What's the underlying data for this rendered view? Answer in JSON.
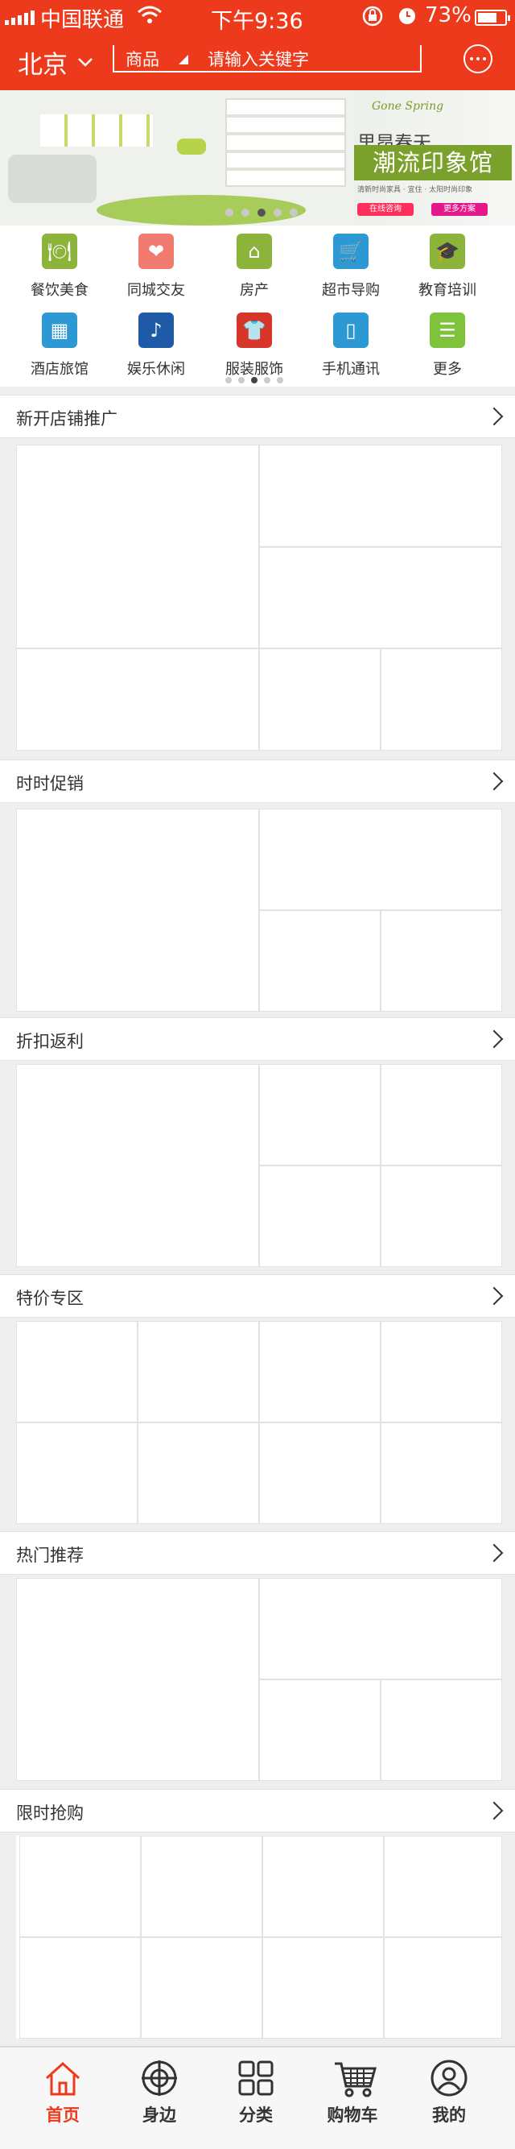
{
  "status": {
    "carrier": "中国联通",
    "time": "下午9:36",
    "battery": "73%",
    "battery_level": 0.73
  },
  "header": {
    "city": "北京",
    "search_category": "商品",
    "search_placeholder": "请输入关键字",
    "accent": "#ed3a1c"
  },
  "banner": {
    "script_text": "Gone Spring",
    "title_1": "里昂春天",
    "title_2": "潮流印象馆",
    "small_text": "清新时尚家具 · 宜住 · 太阳时尚印象",
    "button_1": "在线咨询",
    "button_2": "更多方案",
    "slide_count": 5,
    "active_slide": 3
  },
  "categories": {
    "items": [
      {
        "label": "餐饮美食",
        "icon": "dining-icon",
        "color": "#8cb33a",
        "glyph": "🍽"
      },
      {
        "label": "同城交友",
        "icon": "heart-icon",
        "color": "#f07b6e",
        "glyph": "❤"
      },
      {
        "label": "房产",
        "icon": "house-icon",
        "color": "#8cb33a",
        "glyph": "⌂"
      },
      {
        "label": "超市导购",
        "icon": "cart-icon",
        "color": "#2c98d4",
        "glyph": "🛒"
      },
      {
        "label": "教育培训",
        "icon": "graduate-icon",
        "color": "#8cb33a",
        "glyph": "🎓"
      },
      {
        "label": "酒店旅馆",
        "icon": "hotel-icon",
        "color": "#2c98d4",
        "glyph": "▦"
      },
      {
        "label": "娱乐休闲",
        "icon": "entertainment-icon",
        "color": "#1e5aa8",
        "glyph": "♪"
      },
      {
        "label": "服装服饰",
        "icon": "clothing-icon",
        "color": "#d8352a",
        "glyph": "👕"
      },
      {
        "label": "手机通讯",
        "icon": "phone-icon",
        "color": "#2c98d4",
        "glyph": "▯"
      },
      {
        "label": "更多",
        "icon": "more-list-icon",
        "color": "#7ec33b",
        "glyph": "☰"
      }
    ],
    "page_count": 5,
    "active_page": 3
  },
  "sections": [
    {
      "title": "新开店铺推广"
    },
    {
      "title": "时时促销"
    },
    {
      "title": "折扣返利"
    },
    {
      "title": "特价专区"
    },
    {
      "title": "热门推荐"
    },
    {
      "title": "限时抢购"
    }
  ],
  "tabbar": {
    "items": [
      {
        "label": "首页",
        "icon": "home-icon",
        "active": true
      },
      {
        "label": "身边",
        "icon": "nearby-target-icon",
        "active": false
      },
      {
        "label": "分类",
        "icon": "category-grid-icon",
        "active": false
      },
      {
        "label": "购物车",
        "icon": "shopping-cart-icon",
        "active": false
      },
      {
        "label": "我的",
        "icon": "user-icon",
        "active": false
      }
    ]
  }
}
